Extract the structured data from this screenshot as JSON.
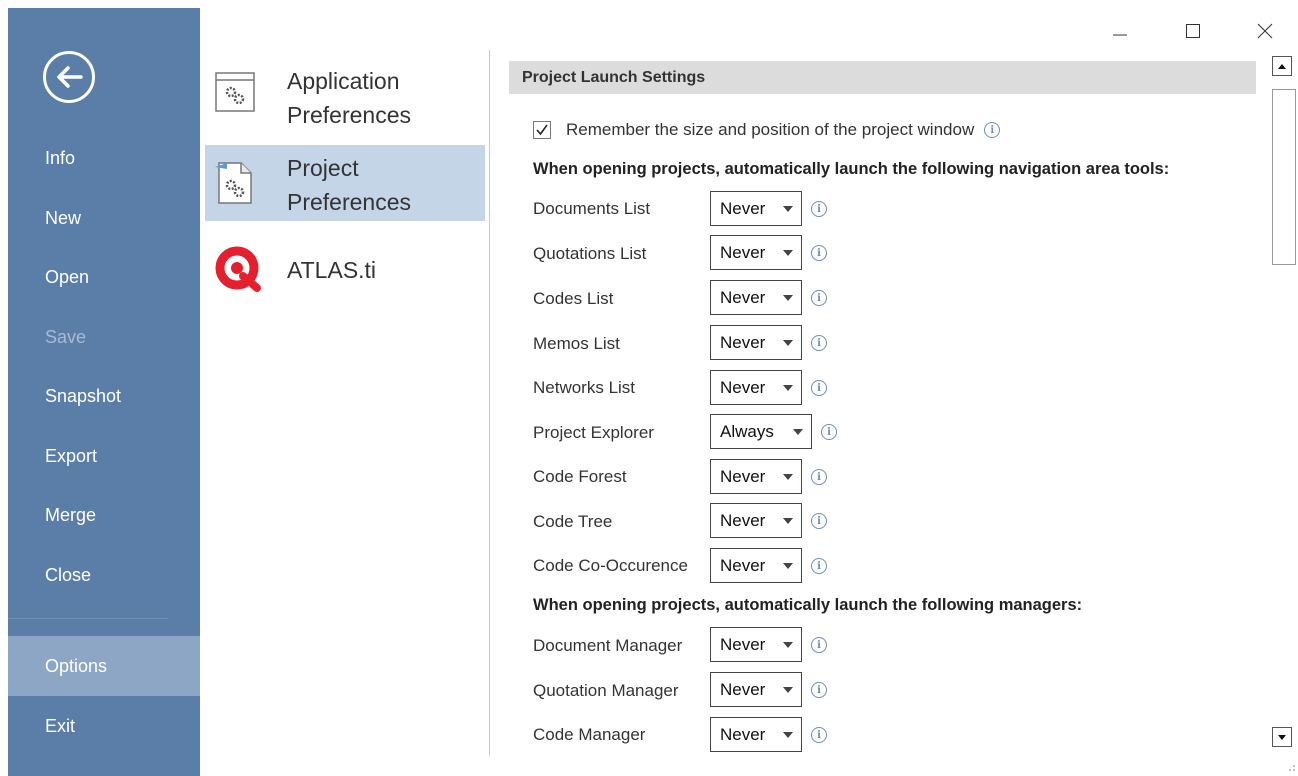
{
  "nav": {
    "back_icon": "arrow-left-circle-icon",
    "items": [
      {
        "label": "Info"
      },
      {
        "label": "New"
      },
      {
        "label": "Open"
      },
      {
        "label": "Save"
      },
      {
        "label": "Snapshot"
      },
      {
        "label": "Export"
      },
      {
        "label": "Merge"
      },
      {
        "label": "Close"
      },
      {
        "label": "Options"
      },
      {
        "label": "Exit"
      }
    ],
    "disabled_item": "Save",
    "selected_item": "Options"
  },
  "categories": [
    {
      "line1": "Application",
      "line2": "Preferences",
      "icon": "gears-window-icon"
    },
    {
      "line1": "Project",
      "line2": "Preferences",
      "icon": "gears-document-icon"
    },
    {
      "line1": "ATLAS.ti",
      "line2": "",
      "icon": "atlasti-logo-icon"
    }
  ],
  "settings": {
    "section_title": "Project Launch Settings",
    "remember_window": {
      "label": "Remember the size and position of the project window",
      "checked": true
    },
    "nav_tools_heading": "When opening projects, automatically launch the following navigation area tools:",
    "nav_tools": [
      {
        "label": "Documents List",
        "value": "Never"
      },
      {
        "label": "Quotations List",
        "value": "Never"
      },
      {
        "label": "Codes List",
        "value": "Never"
      },
      {
        "label": "Memos List",
        "value": "Never"
      },
      {
        "label": "Networks List",
        "value": "Never"
      },
      {
        "label": "Project Explorer",
        "value": "Always"
      },
      {
        "label": "Code Forest",
        "value": "Never"
      },
      {
        "label": "Code Tree",
        "value": "Never"
      },
      {
        "label": "Code Co-Occurence",
        "value": "Never"
      }
    ],
    "managers_heading": "When opening projects, automatically launch the following managers:",
    "managers": [
      {
        "label": "Document Manager",
        "value": "Never"
      },
      {
        "label": "Quotation Manager",
        "value": "Never"
      },
      {
        "label": "Code Manager",
        "value": "Never"
      }
    ]
  },
  "colors": {
    "nav_bg": "#5b7ea8",
    "nav_selected": "#8ea6c5",
    "category_selected": "#c5d5e8",
    "section_bg": "#dcdcdc",
    "atlas_red": "#e5202e"
  }
}
